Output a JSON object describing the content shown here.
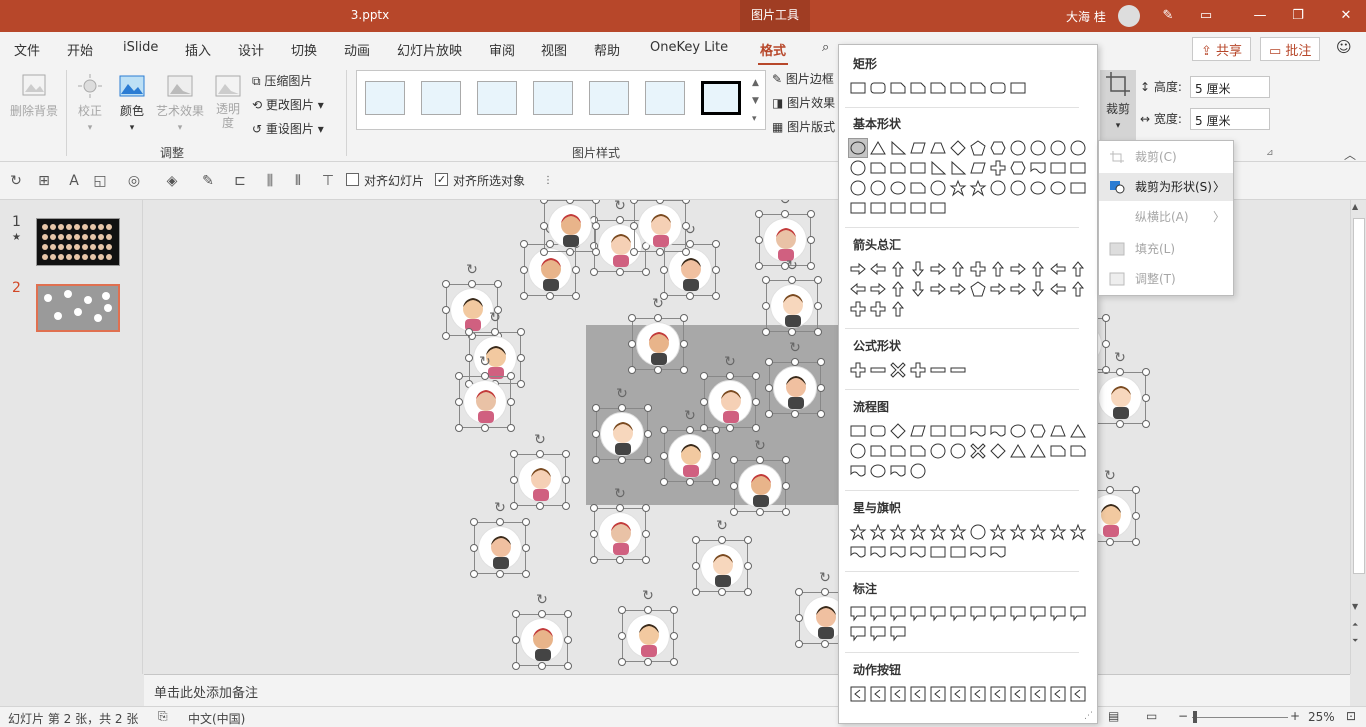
{
  "window": {
    "title": "3.pptx",
    "tool_tab": "图片工具",
    "user_name": "大海 桂"
  },
  "menu": {
    "tabs": [
      "文件",
      "开始",
      "iSlide",
      "插入",
      "设计",
      "切换",
      "动画",
      "幻灯片放映",
      "审阅",
      "视图",
      "帮助",
      "OneKey Lite",
      "格式"
    ],
    "active": "格式",
    "search_label": "搜索",
    "share_label": "共享",
    "comment_label": "批注"
  },
  "ribbon": {
    "adjust": {
      "remove_bg": "删除背景",
      "correct": "校正",
      "color": "颜色",
      "artistic": "艺术效果",
      "transparency": "透明度",
      "compress": "压缩图片",
      "change": "更改图片",
      "reset": "重设图片",
      "group_label": "调整"
    },
    "styles": {
      "group_label": "图片样式",
      "border": "图片边框",
      "effect": "图片效果",
      "layout": "图片版式"
    },
    "size": {
      "crop": "裁剪",
      "height_label": "高度:",
      "height_value": "5 厘米",
      "width_label": "宽度:",
      "width_value": "5 厘米"
    }
  },
  "toolbar": {
    "align_slide": "对齐幻灯片",
    "align_selected": "对齐所选对象"
  },
  "slides": {
    "items": [
      {
        "number": "1",
        "star": "★"
      },
      {
        "number": "2",
        "star": ""
      }
    ]
  },
  "notes": {
    "placeholder": "单击此处添加备注"
  },
  "status": {
    "slide_info": "幻灯片 第 2 张，共 2 张",
    "language": "中文(中国)",
    "zoom": "25%"
  },
  "shape_menu": {
    "sections": [
      "矩形",
      "基本形状",
      "箭头总汇",
      "公式形状",
      "流程图",
      "星与旗帜",
      "标注",
      "动作按钮"
    ]
  },
  "crop_menu": {
    "items": [
      "裁剪(C)",
      "裁剪为形状(S)",
      "纵横比(A)",
      "填充(L)",
      "调整(T)"
    ]
  },
  "colors": {
    "accent": "#b7472a",
    "slide_gray": "#a8a8a8"
  }
}
